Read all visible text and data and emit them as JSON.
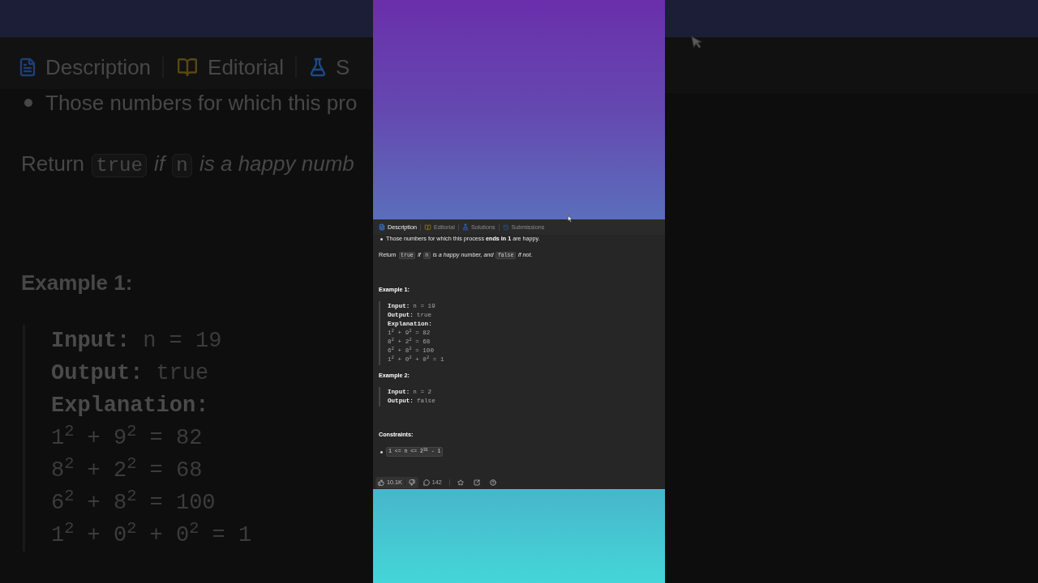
{
  "backdrop_left": {
    "tabs": [
      "Description",
      "Editorial",
      "S"
    ],
    "bullet": "Those numbers for which this pro",
    "return_line": [
      {
        "kind": "text",
        "text": "Return "
      },
      {
        "kind": "code",
        "text": "true"
      },
      {
        "kind": "italic",
        "text": " if "
      },
      {
        "kind": "code",
        "text": "n"
      },
      {
        "kind": "italic",
        "text": " is a happy numb"
      }
    ],
    "example_heading": "Example 1:",
    "example_lines": [
      {
        "label": "Input:",
        "value": "n = 19"
      },
      {
        "label": "Output:",
        "value": "true"
      },
      {
        "label": "Explanation:"
      }
    ],
    "explanation": [
      "1$^{2}$ + 9$^{2}$ = 82",
      "8$^{2}$ + 2$^{2}$ = 68",
      "6$^{2}$ + 8$^{2}$ = 100",
      "1$^{2}$ + 0$^{2}$ + 0$^{2}$ = 1"
    ]
  },
  "panel": {
    "tabs": [
      {
        "label": "Description",
        "selected": true
      },
      {
        "label": "Editorial",
        "selected": false
      },
      {
        "label": "Solutions",
        "selected": false
      },
      {
        "label": "Submissions",
        "selected": false
      }
    ],
    "bullet": "Those numbers for which this process **ends in 1** are happy.",
    "return_line": [
      {
        "kind": "text",
        "text": "Return "
      },
      {
        "kind": "code",
        "text": "true"
      },
      {
        "kind": "italic",
        "text": " if "
      },
      {
        "kind": "code",
        "text": "n"
      },
      {
        "kind": "italic",
        "text": " is a happy number, and "
      },
      {
        "kind": "code",
        "text": "false"
      },
      {
        "kind": "italic",
        "text": " if not."
      }
    ],
    "examples": [
      {
        "heading": "Example 1:",
        "lines": [
          {
            "label": "Input:",
            "value": "n = 19"
          },
          {
            "label": "Output:",
            "value": "true"
          },
          {
            "label": "Explanation:"
          }
        ],
        "explanation": [
          "1$^{2}$ + 9$^{2}$ = 82",
          "8$^{2}$ + 2$^{2}$ = 68",
          "6$^{2}$ + 8$^{2}$ = 100",
          "1$^{2}$ + 0$^{2}$ + 0$^{2}$ = 1"
        ]
      },
      {
        "heading": "Example 2:",
        "lines": [
          {
            "label": "Input:",
            "value": "n = 2"
          },
          {
            "label": "Output:",
            "value": "false"
          }
        ]
      }
    ],
    "constraints": {
      "heading": "Constraints:",
      "items": [
        "1 <= n <= 2$^{31}$ - 1"
      ]
    },
    "footer": {
      "likes": "10.1K",
      "comments": "142"
    }
  }
}
